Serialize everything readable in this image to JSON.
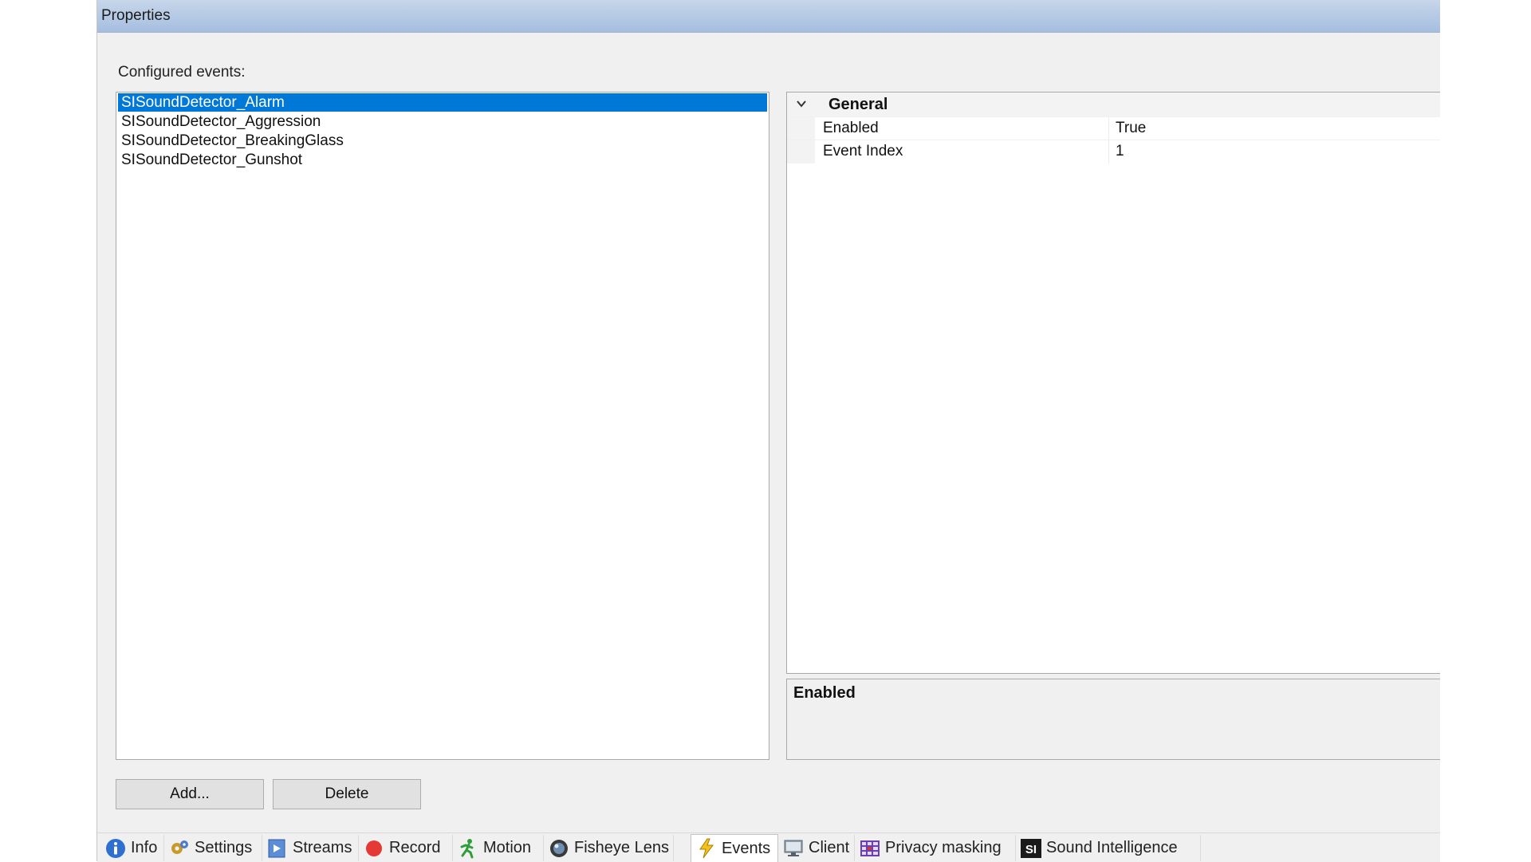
{
  "window": {
    "title": "Properties"
  },
  "events_panel": {
    "label": "Configured events:",
    "items": [
      "SISoundDetector_Alarm",
      "SISoundDetector_Aggression",
      "SISoundDetector_BreakingGlass",
      "SISoundDetector_Gunshot"
    ],
    "selected_index": 0
  },
  "property_grid": {
    "category": "General",
    "properties": [
      {
        "name": "Enabled",
        "value": "True"
      },
      {
        "name": "Event Index",
        "value": "1"
      }
    ],
    "description_title": "Enabled"
  },
  "buttons": {
    "add": "Add...",
    "delete": "Delete"
  },
  "tabs": [
    {
      "label": "Info",
      "icon": "info-icon",
      "active": false
    },
    {
      "label": "Settings",
      "icon": "gear-icon",
      "active": false
    },
    {
      "label": "Streams",
      "icon": "streams-icon",
      "active": false
    },
    {
      "label": "Record",
      "icon": "record-icon",
      "active": false
    },
    {
      "label": "Motion",
      "icon": "motion-icon",
      "active": false
    },
    {
      "label": "Fisheye Lens",
      "icon": "fisheye-lens-icon",
      "active": false
    },
    {
      "label": "Events",
      "icon": "events-icon",
      "active": true
    },
    {
      "label": "Client",
      "icon": "client-icon",
      "active": false
    },
    {
      "label": "Privacy masking",
      "icon": "privacy-masking-icon",
      "active": false
    },
    {
      "label": "Sound Intelligence",
      "icon": "sound-intelligence-icon",
      "active": false
    }
  ],
  "colors": {
    "selection": "#0078d7",
    "titlebar": "#b4c9e4",
    "record_red": "#e53935"
  },
  "icons": {
    "sound_intelligence_logo_text": "SI"
  }
}
